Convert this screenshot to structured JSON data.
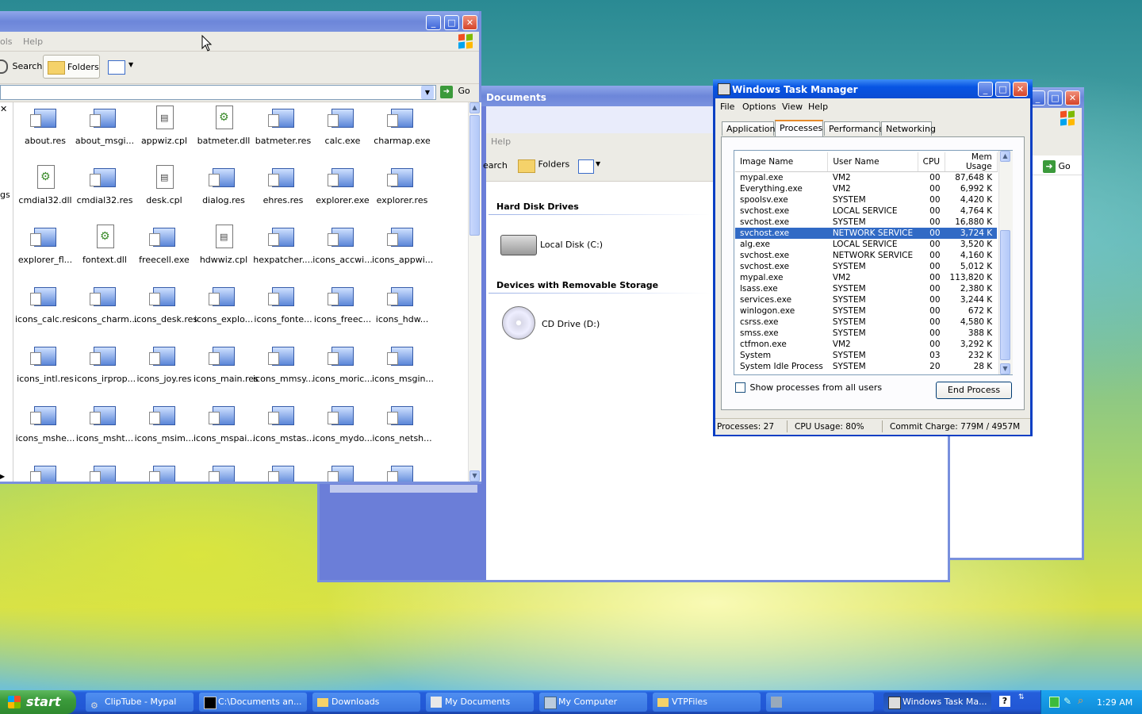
{
  "explorer_main": {
    "menu": {
      "tools_partial": "ols",
      "help": "Help"
    },
    "toolbar": {
      "search": "Search",
      "folders": "Folders"
    },
    "address": {
      "go": "Go"
    },
    "left_fragment": "gs",
    "files": [
      "about.res",
      "about_msgi...",
      "appwiz.cpl",
      "batmeter.dll",
      "batmeter.res",
      "calc.exe",
      "charmap.exe",
      "cmdial32.dll",
      "cmdial32.res",
      "desk.cpl",
      "dialog.res",
      "ehres.res",
      "explorer.exe",
      "explorer.res",
      "explorer_fl...",
      "fontext.dll",
      "freecell.exe",
      "hdwwiz.cpl",
      "hexpatcher....",
      "icons_accwi...",
      "icons_appwi...",
      "icons_calc.res",
      "icons_charm...",
      "icons_desk.res",
      "icons_explo...",
      "icons_fonte...",
      "icons_freec...",
      "icons_hdw...",
      "icons_intl.res",
      "icons_irprop...",
      "icons_joy.res",
      "icons_main.res",
      "icons_mmsy...",
      "icons_moric...",
      "icons_msgin...",
      "icons_mshe...",
      "icons_msht...",
      "icons_msim...",
      "icons_mspai...",
      "icons_mstas...",
      "icons_mydo...",
      "icons_netsh..."
    ]
  },
  "mycomputer": {
    "title": "Documents",
    "menu_help": "Help",
    "toolbar": {
      "search_partial": "earch",
      "folders": "Folders"
    },
    "section_hdd": "Hard Disk Drives",
    "drive_c": "Local Disk (C:)",
    "section_removable": "Devices with Removable Storage",
    "drive_d": "CD Drive (D:)"
  },
  "back_window": {
    "go": "Go"
  },
  "taskmgr": {
    "title": "Windows Task Manager",
    "menu": [
      "File",
      "Options",
      "View",
      "Help"
    ],
    "tabs": [
      "Applications",
      "Processes",
      "Performance",
      "Networking"
    ],
    "columns": [
      "Image Name",
      "User Name",
      "CPU",
      "Mem Usage"
    ],
    "rows": [
      [
        "mypal.exe",
        "VM2",
        "00",
        "87,648 K"
      ],
      [
        "Everything.exe",
        "VM2",
        "00",
        "6,992 K"
      ],
      [
        "spoolsv.exe",
        "SYSTEM",
        "00",
        "4,420 K"
      ],
      [
        "svchost.exe",
        "LOCAL SERVICE",
        "00",
        "4,764 K"
      ],
      [
        "svchost.exe",
        "SYSTEM",
        "00",
        "16,880 K"
      ],
      [
        "svchost.exe",
        "NETWORK SERVICE",
        "00",
        "3,724 K"
      ],
      [
        "alg.exe",
        "LOCAL SERVICE",
        "00",
        "3,520 K"
      ],
      [
        "svchost.exe",
        "NETWORK SERVICE",
        "00",
        "4,160 K"
      ],
      [
        "svchost.exe",
        "SYSTEM",
        "00",
        "5,012 K"
      ],
      [
        "mypal.exe",
        "VM2",
        "00",
        "113,820 K"
      ],
      [
        "lsass.exe",
        "SYSTEM",
        "00",
        "2,380 K"
      ],
      [
        "services.exe",
        "SYSTEM",
        "00",
        "3,244 K"
      ],
      [
        "winlogon.exe",
        "SYSTEM",
        "00",
        "672 K"
      ],
      [
        "csrss.exe",
        "SYSTEM",
        "00",
        "4,580 K"
      ],
      [
        "smss.exe",
        "SYSTEM",
        "00",
        "388 K"
      ],
      [
        "ctfmon.exe",
        "VM2",
        "00",
        "3,292 K"
      ],
      [
        "System",
        "SYSTEM",
        "03",
        "232 K"
      ],
      [
        "System Idle Process",
        "SYSTEM",
        "20",
        "28 K"
      ]
    ],
    "show_all": "Show processes from all users",
    "end_process": "End Process",
    "status": {
      "processes": "Processes: 27",
      "cpu": "CPU Usage: 80%",
      "commit": "Commit Charge: 779M / 4957M"
    }
  },
  "taskbar": {
    "start": "start",
    "buttons": [
      "ClipTube - Mypal",
      "C:\\Documents an...",
      "Downloads",
      "My Documents",
      "My Computer",
      "VTPFiles",
      "",
      "Windows Task Ma..."
    ],
    "clock": "1:29 AM"
  }
}
